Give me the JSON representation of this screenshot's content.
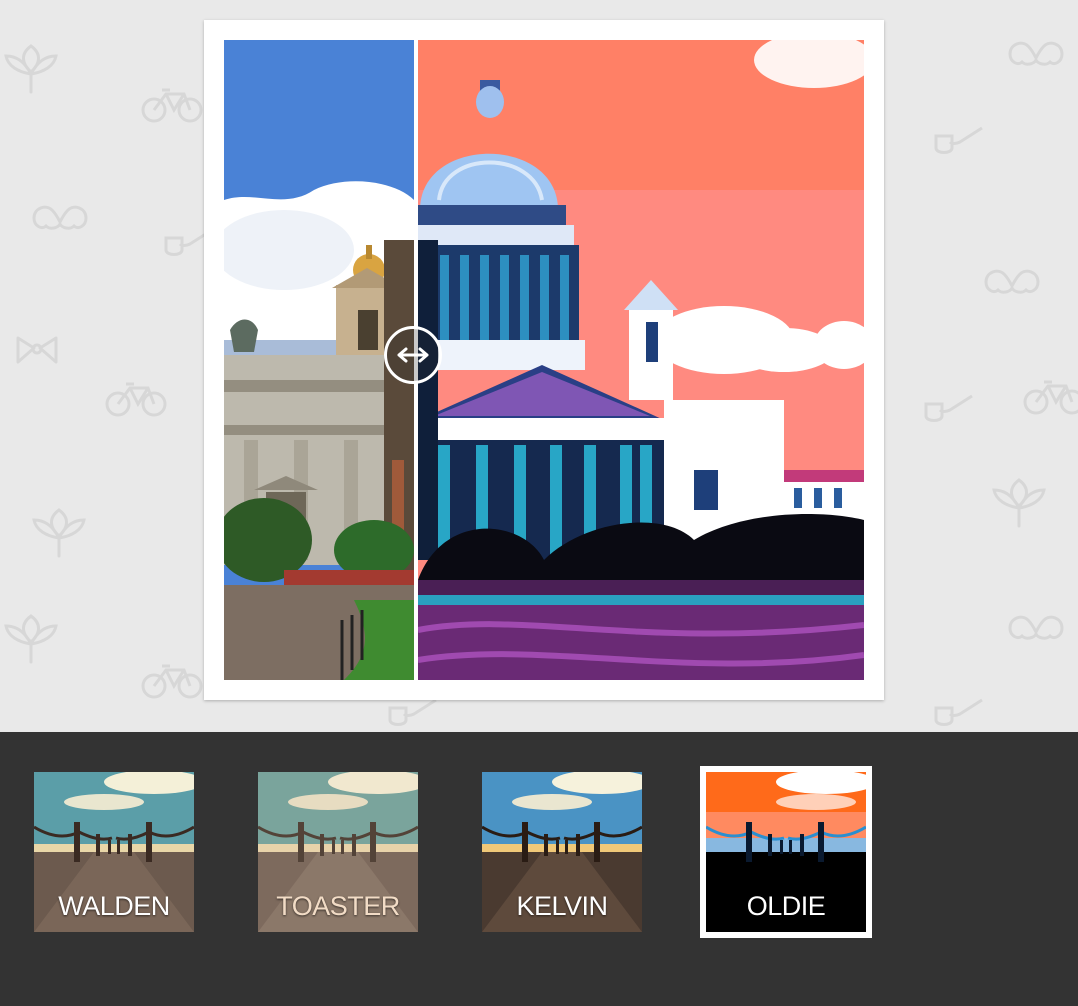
{
  "filters": [
    {
      "label": "WALDEN",
      "selected": false
    },
    {
      "label": "TOASTER",
      "selected": false
    },
    {
      "label": "KELVIN",
      "selected": false
    },
    {
      "label": "OLDIE",
      "selected": true
    }
  ],
  "compare": {
    "split_fraction": 0.3,
    "handle_icon": "left-right-arrow-icon"
  },
  "colors": {
    "bar_background": "#333333",
    "page_background": "#e9e9e9",
    "oldie_sky": "#ff8a80",
    "original_sky": "#4a82d6"
  }
}
